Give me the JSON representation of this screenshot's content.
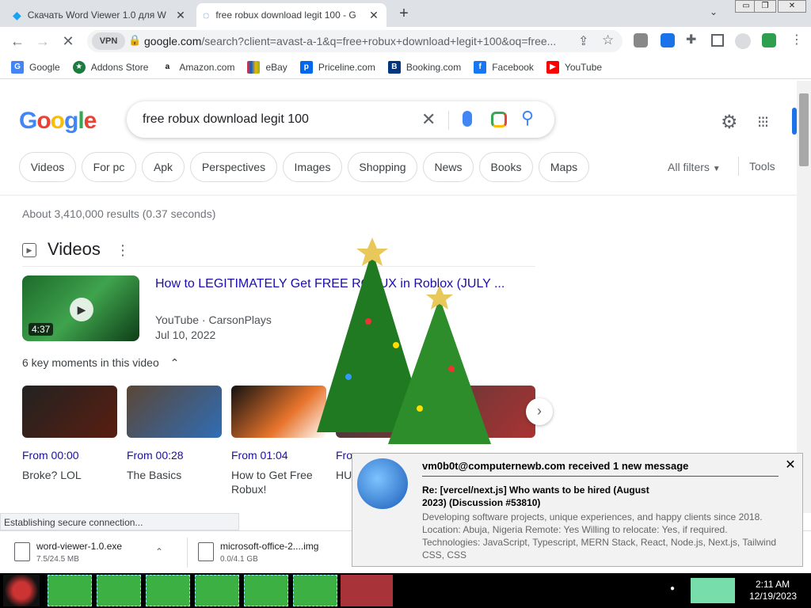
{
  "tabs": [
    {
      "title": "Скачать Word Viewer 1.0 для W",
      "close": "✕"
    },
    {
      "title": "free robux download legit 100 - G",
      "close": "✕"
    }
  ],
  "new_tab": "+",
  "window_controls": {
    "min": "▭",
    "restore": "❐",
    "close": "✕"
  },
  "toolbar": {
    "back": "←",
    "forward": "→",
    "reload": "✕",
    "vpn": "VPN",
    "url_host": "google.com",
    "url_path": "/search?client=avast-a-1&q=free+robux+download+legit+100&oq=free..."
  },
  "bookmarks": [
    {
      "label": "Google",
      "icon": "google-icon",
      "color": "#4285f4"
    },
    {
      "label": "Addons Store",
      "icon": "addons-store-icon",
      "color": "#1b7b40"
    },
    {
      "label": "Amazon.com",
      "icon": "amazon-icon",
      "color": "#111111"
    },
    {
      "label": "eBay",
      "icon": "ebay-icon",
      "color": "#e53238"
    },
    {
      "label": "Priceline.com",
      "icon": "priceline-icon",
      "color": "#0068ef"
    },
    {
      "label": "Booking.com",
      "icon": "booking-icon",
      "color": "#003580"
    },
    {
      "label": "Facebook",
      "icon": "facebook-icon",
      "color": "#1877f2"
    },
    {
      "label": "YouTube",
      "icon": "youtube-icon",
      "color": "#ff0000"
    }
  ],
  "search": {
    "logo": "Google",
    "query": "free robux download legit 100",
    "chips": [
      "Videos",
      "For pc",
      "Apk",
      "Perspectives",
      "Images",
      "Shopping",
      "News",
      "Books",
      "Maps"
    ],
    "all_filters": "All filters",
    "tools": "Tools",
    "result_stats": "About 3,410,000 results (0.37 seconds)"
  },
  "videos": {
    "heading": "Videos",
    "title": "How to LEGITIMATELY Get FREE ROBUX in Roblox (JULY ...",
    "duration": "4:37",
    "source": "YouTube · CarsonPlays",
    "date": "Jul 10, 2022",
    "key_moments_label": "6 key moments in this video",
    "key_moments": [
      {
        "time": "From 00:00",
        "label": "Broke? LOL"
      },
      {
        "time": "From 00:28",
        "label": "The Basics"
      },
      {
        "time": "From 01:04",
        "label": "How to Get Free Robux!"
      },
      {
        "time": "From",
        "label": "HU"
      }
    ]
  },
  "status_text": "Establishing secure connection...",
  "downloads": [
    {
      "name": "word-viewer-1.0.exe",
      "size": "7.5/24.5 MB"
    },
    {
      "name": "microsoft-office-2....img",
      "size": "0.0/4.1 GB"
    }
  ],
  "notification": {
    "title": "vm0b0t@computernewb.com received 1 new message",
    "subject": "Re: [vercel/next.js] Who wants to be hired (August 2023) (Discussion #53810)",
    "body": "Developing software projects, unique experiences, and happy clients since 2018. Location: Abuja, Nigeria Remote: Yes Willing to relocate: Yes, if required. Technologies: JavaScript, Typescript, MERN Stack, React, Node.js, Next.js, Tailwind CSS, CSS",
    "close": "✕"
  },
  "clock": {
    "time": "2:11 AM",
    "date": "12/19/2023"
  }
}
